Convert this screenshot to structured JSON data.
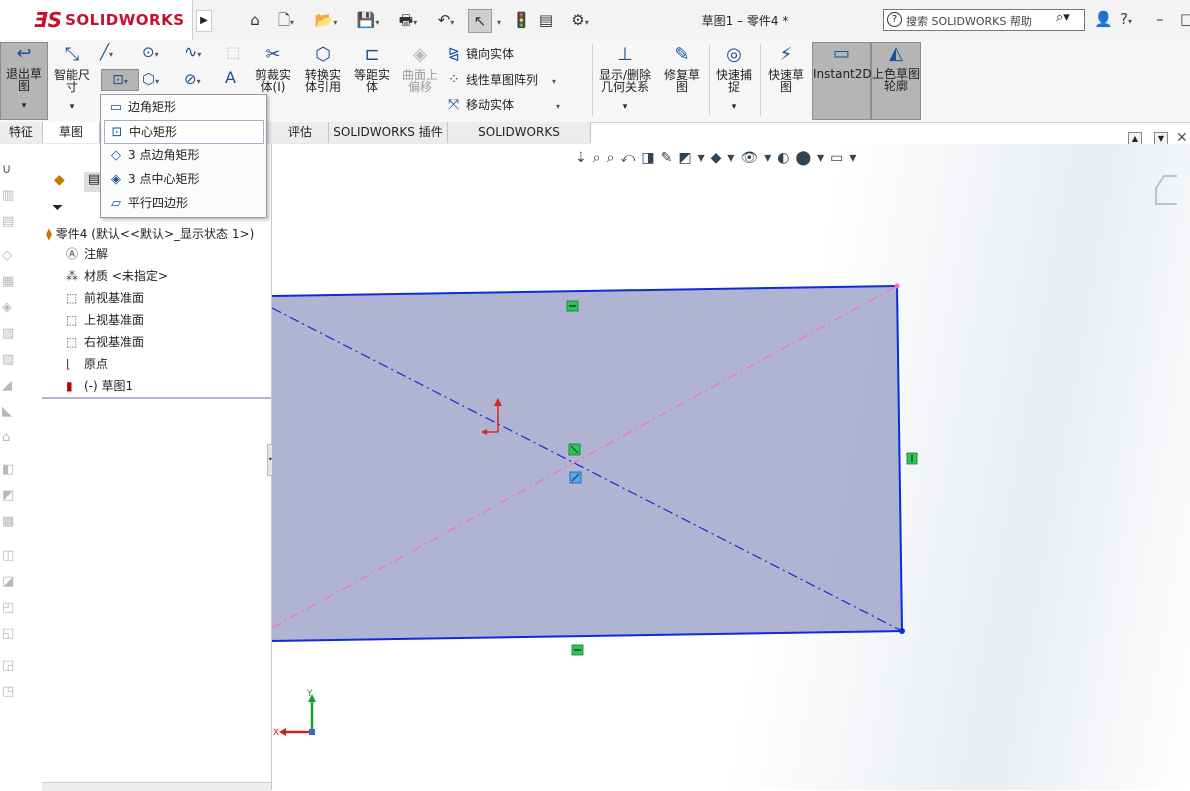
{
  "app": {
    "brand_ds": "ƎS",
    "brand_name": "SOLIDWORKS",
    "document_title": "草图1 – 零件4 *",
    "help_search_placeholder": "搜索 SOLIDWORKS 帮助"
  },
  "command_manager": {
    "exit_sketch": "退出草图",
    "smart_dimension": "智能尺寸",
    "trim_entities": "剪裁实体(I)",
    "convert_entities": "转换实体引用",
    "offset_entities": "等距实体",
    "offset_on_surface": "曲面上偏移",
    "mirror_entities": "镜向实体",
    "linear_pattern": "线性草图阵列",
    "move_entities": "移动实体",
    "display_relations": "显示/删除几何关系",
    "repair_sketch": "修复草图",
    "quick_snaps": "快速捕捉",
    "rapid_sketch": "快速草图",
    "instant2d": "Instant2D",
    "shaded_sketch": "上色草图轮廓"
  },
  "tabs": [
    "特征",
    "草图",
    "评估",
    "SOLIDWORKS 插件",
    "SOLIDWORKS Inspection"
  ],
  "rect_menu": {
    "items": [
      {
        "label": "边角矩形",
        "icon": "corner-rectangle-icon"
      },
      {
        "label": "中心矩形",
        "icon": "center-rectangle-icon"
      },
      {
        "label": "3 点边角矩形",
        "icon": "3point-corner-rectangle-icon"
      },
      {
        "label": "3 点中心矩形",
        "icon": "3point-center-rectangle-icon"
      },
      {
        "label": "平行四边形",
        "icon": "parallelogram-icon"
      }
    ],
    "highlighted_index": 1
  },
  "feature_tree": {
    "root": "零件4  (默认<<默认>_显示状态 1>)",
    "items": [
      {
        "label": "注解",
        "icon": "annotations-icon"
      },
      {
        "label": "材质 <未指定>",
        "icon": "material-icon"
      },
      {
        "label": "前视基准面",
        "icon": "plane-icon"
      },
      {
        "label": "上视基准面",
        "icon": "plane-icon"
      },
      {
        "label": "右视基准面",
        "icon": "plane-icon"
      },
      {
        "label": "原点",
        "icon": "origin-icon"
      },
      {
        "label": "(-) 草图1",
        "icon": "sketch-icon"
      }
    ]
  },
  "triad": {
    "x": "X",
    "y": "Y"
  },
  "colors": {
    "sketch_fill": "#9fa3c9",
    "sketch_line": "#0d2cd8",
    "construction": "#ff66cc",
    "relation_green": "#2ec45a"
  }
}
